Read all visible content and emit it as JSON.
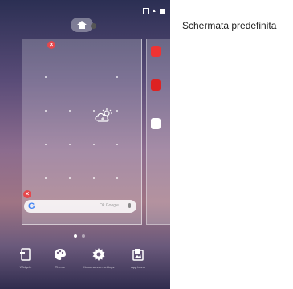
{
  "callout": {
    "label": "Schermata predefinita"
  },
  "status_bar": {
    "battery": "",
    "time": ""
  },
  "home_screen": {
    "weather_widget": "weather-icon",
    "search_bar": {
      "logo": "G",
      "placeholder": "Ok Google"
    }
  },
  "dock": {
    "items": [
      {
        "icon": "widgets-icon",
        "label": "Widgets"
      },
      {
        "icon": "themes-icon",
        "label": "Theme"
      },
      {
        "icon": "settings-icon",
        "label": "Home screen settings"
      },
      {
        "icon": "wallpaper-icon",
        "label": "App icons"
      }
    ]
  },
  "pager": {
    "pages": 2,
    "current": 1
  },
  "colors": {
    "remove": "#e5484d",
    "google_blue": "#4285f4"
  }
}
